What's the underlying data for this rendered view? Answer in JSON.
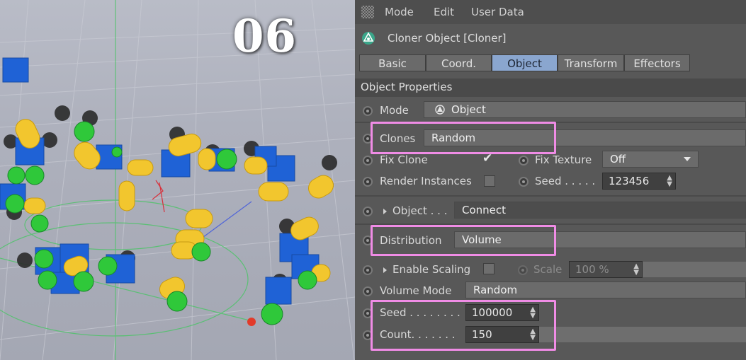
{
  "overlay": {
    "step_number": "06"
  },
  "menubar": {
    "items": [
      "Mode",
      "Edit",
      "User Data"
    ]
  },
  "header": {
    "title": "Cloner Object [Cloner]"
  },
  "tabs": [
    {
      "label": "Basic",
      "active": false
    },
    {
      "label": "Coord.",
      "active": false
    },
    {
      "label": "Object",
      "active": true
    },
    {
      "label": "Transform",
      "active": false
    },
    {
      "label": "Effectors",
      "active": false
    }
  ],
  "section": {
    "title": "Object Properties"
  },
  "props": {
    "mode": {
      "label": "Mode",
      "value": "Object"
    },
    "clones": {
      "label": "Clones",
      "value": "Random"
    },
    "fix_clone": {
      "label": "Fix Clone",
      "checked": "✔"
    },
    "fix_texture": {
      "label": "Fix Texture",
      "value": "Off"
    },
    "render_instances": {
      "label": "Render Instances"
    },
    "seed_top": {
      "label": "Seed . . . . .",
      "value": "123456"
    },
    "object": {
      "label": "Object . . .",
      "value": "Connect"
    },
    "distribution": {
      "label": "Distribution",
      "value": "Volume"
    },
    "enable_scaling": {
      "label": "Enable Scaling"
    },
    "scale": {
      "label": "Scale",
      "value": "100 %"
    },
    "volume_mode": {
      "label": "Volume Mode",
      "value": "Random"
    },
    "seed": {
      "label": "Seed . . . . . . . .",
      "value": "100000"
    },
    "count": {
      "label": "Count. . . . . . .",
      "value": "150"
    }
  },
  "colors": {
    "highlight": "#f08ce6",
    "active_tab": "#8aa6cf",
    "panel": "#585858"
  }
}
